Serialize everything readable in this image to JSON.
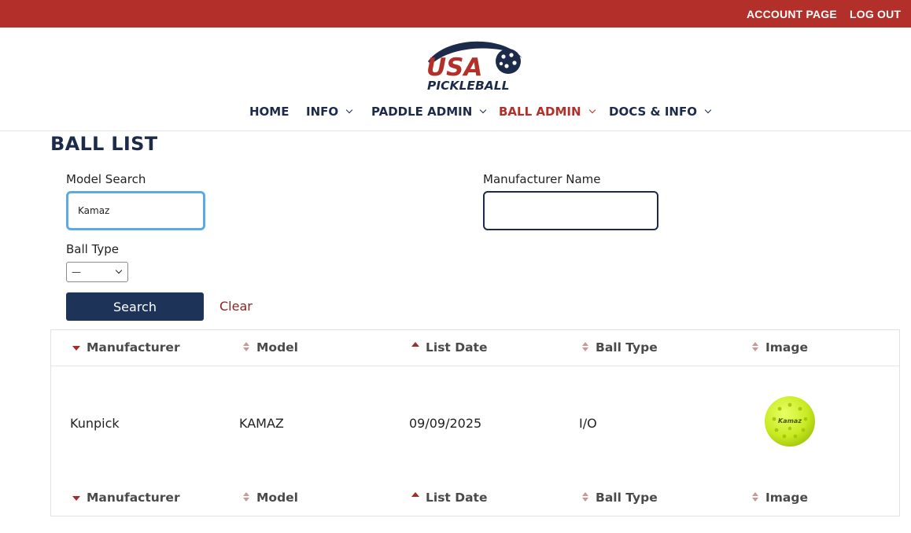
{
  "topbar": {
    "account_label": "ACCOUNT PAGE",
    "logout_label": "LOG OUT",
    "color": "#b3302a"
  },
  "logo": {
    "line1": "USA",
    "line2": "PICKLEBALL"
  },
  "nav": {
    "items": [
      {
        "label": "HOME"
      },
      {
        "label": "INFO"
      },
      {
        "label": "PADDLE ADMIN"
      },
      {
        "label": "BALL ADMIN",
        "active": true
      },
      {
        "label": "DOCS & INFO"
      }
    ]
  },
  "page": {
    "title": "BALL LIST"
  },
  "filters": {
    "model_label": "Model Search",
    "model_value": "Kamaz",
    "manufacturer_label": "Manufacturer Name",
    "manufacturer_value": "",
    "ball_type_label": "Ball Type",
    "ball_type_selected": "—",
    "search_label": "Search",
    "clear_label": "Clear"
  },
  "table": {
    "columns": [
      "Manufacturer",
      "Model",
      "List Date",
      "Ball Type",
      "Image"
    ],
    "sort_states": [
      "desc",
      "both",
      "asc",
      "both",
      "both"
    ],
    "rows": [
      {
        "manufacturer": "Kunpick",
        "model": "KAMAZ",
        "list_date": "09/09/2025",
        "ball_type": "I/O",
        "image_icon": "ball-image-icon",
        "image_text": "Kamaz"
      }
    ]
  },
  "colors": {
    "navy": "#1d2b4a",
    "accent_red": "#b3302a",
    "focus_blue": "#5fa9e1",
    "button_navy": "#1d3358"
  }
}
